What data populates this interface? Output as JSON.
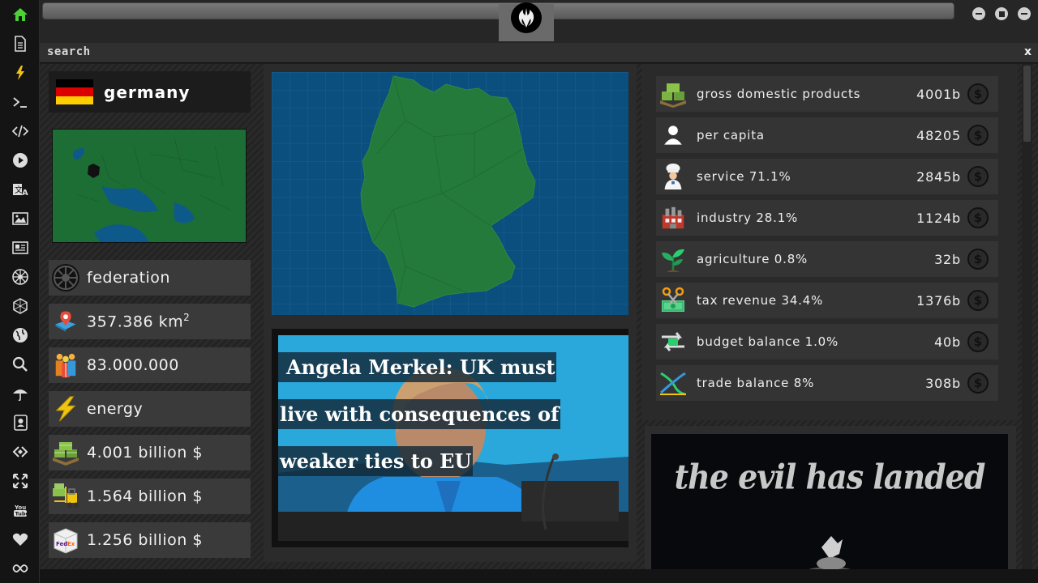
{
  "topbar": {
    "emblem_icon": "rebel-alliance-icon",
    "window_buttons": [
      "minimize-icon",
      "maximize-icon",
      "close-icon"
    ]
  },
  "search": {
    "label": "search",
    "close": "x"
  },
  "sidebar": {
    "icons": [
      "home-icon",
      "document-icon",
      "lightning-icon",
      "terminal-icon",
      "code-icon",
      "play-icon",
      "translate-icon",
      "image-icon",
      "newspaper-icon",
      "empire-icon",
      "hexagon-icon",
      "globe-icon",
      "search-icon",
      "umbrella-icon",
      "contact-card-icon",
      "link-icon",
      "fullscreen-icon",
      "youtube-icon",
      "heart-icon",
      "infinity-icon"
    ],
    "accent": "#4cd137"
  },
  "country": {
    "name": "germany",
    "flag_colors": [
      "#000000",
      "#dd0000",
      "#ffce00"
    ]
  },
  "facts": [
    {
      "icon": "empire-icon",
      "text": "federation"
    },
    {
      "icon": "map-pin-icon",
      "text": "357.386 km",
      "sup": "2"
    },
    {
      "icon": "people-icon",
      "text": "83.000.000"
    },
    {
      "icon": "lightning-icon",
      "text": "energy"
    },
    {
      "icon": "money-stack-icon",
      "text": "4.001 billion $"
    },
    {
      "icon": "money-forklift-icon",
      "text": "1.564 billion $"
    },
    {
      "icon": "fedex-box-icon",
      "text": "1.256 billion $"
    }
  ],
  "news": {
    "lines": [
      "Angela Merkel: UK must",
      "live with consequences of",
      "weaker ties to EU"
    ]
  },
  "stats": [
    {
      "icon": "money-stack-icon",
      "label": "gross domestic products",
      "value": "4001b"
    },
    {
      "icon": "person-icon",
      "label": "per capita",
      "value": "48205"
    },
    {
      "icon": "chef-icon",
      "label": "service 71.1%",
      "value": "2845b"
    },
    {
      "icon": "factory-icon",
      "label": "industry 28.1%",
      "value": "1124b"
    },
    {
      "icon": "plant-icon",
      "label": "agriculture 0.8%",
      "value": "32b"
    },
    {
      "icon": "money-scissors-icon",
      "label": "tax revenue 34.4%",
      "value": "1376b"
    },
    {
      "icon": "exchange-icon",
      "label": "budget balance 1.0%",
      "value": "40b"
    },
    {
      "icon": "trade-cross-icon",
      "label": "trade balance 8%",
      "value": "308b"
    }
  ],
  "coin_symbol": "$",
  "banner": {
    "text": "the evil has landed"
  }
}
